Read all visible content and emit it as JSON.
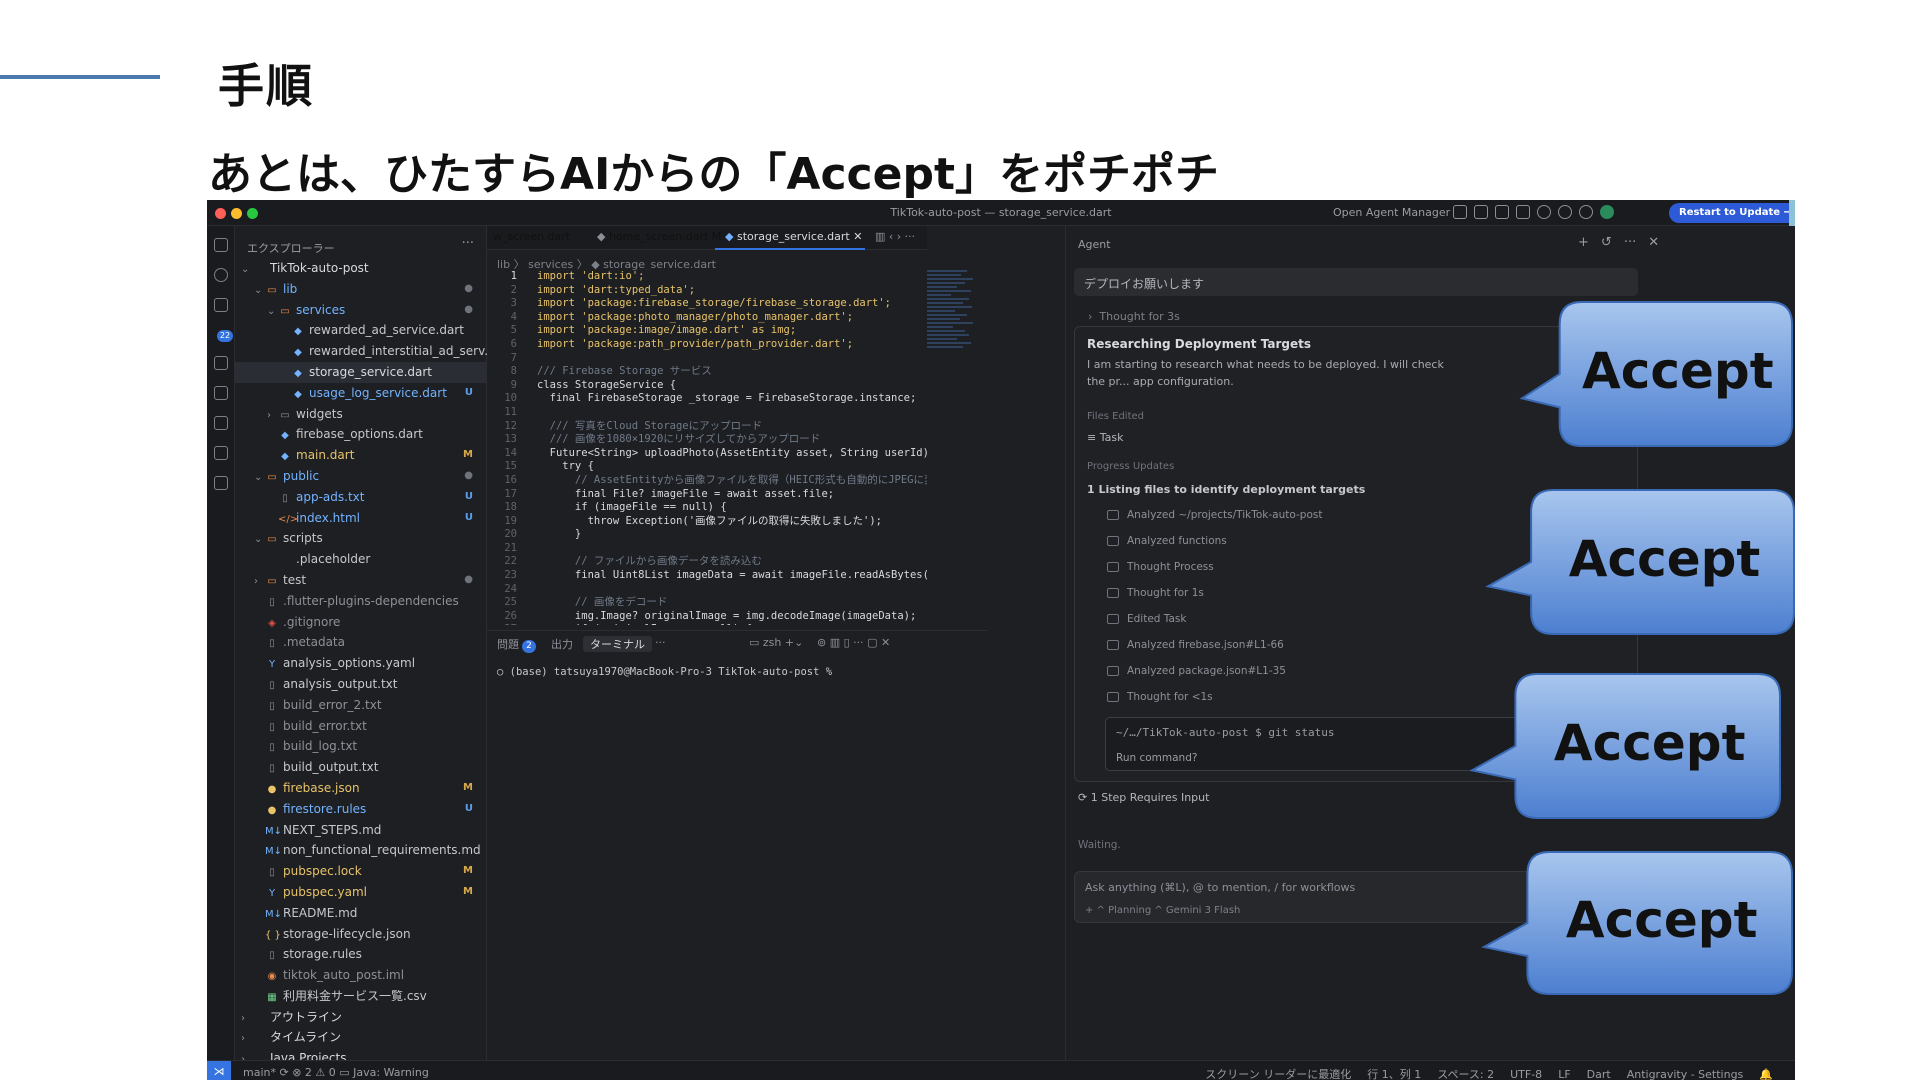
{
  "slide": {
    "title": "手順",
    "subtitle": "あとは、ひたすらAIからの「Accept」をポチポチ"
  },
  "window": {
    "title": "TikTok-auto-post — storage_service.dart",
    "open_agent_manager": "Open Agent Manager",
    "restart_button": "Restart to Update →"
  },
  "activity": {
    "badge": "22"
  },
  "explorer": {
    "header": "エクスプローラー",
    "more": "···",
    "rows": [
      {
        "indent": 0,
        "chev": "⌄",
        "icon": "",
        "icon_class": "",
        "label": "TikTok-auto-post",
        "label_class": "c-white",
        "status": "",
        "status_class": ""
      },
      {
        "indent": 1,
        "chev": "⌄",
        "icon": "▭",
        "icon_class": "c-org",
        "label": "lib",
        "label_class": "c-blue",
        "status": "●",
        "status_class": "st-dot"
      },
      {
        "indent": 2,
        "chev": "⌄",
        "icon": "▭",
        "icon_class": "c-org",
        "label": "services",
        "label_class": "c-blue",
        "status": "●",
        "status_class": "st-dot"
      },
      {
        "indent": 3,
        "chev": "",
        "icon": "◆",
        "icon_class": "c-blue",
        "label": "rewarded_ad_service.dart",
        "label_class": "",
        "status": "",
        "status_class": ""
      },
      {
        "indent": 3,
        "chev": "",
        "icon": "◆",
        "icon_class": "c-blue",
        "label": "rewarded_interstitial_ad_serv...",
        "label_class": "",
        "status": "",
        "status_class": ""
      },
      {
        "indent": 3,
        "chev": "",
        "icon": "◆",
        "icon_class": "c-blue",
        "label": "storage_service.dart",
        "label_class": "c-white",
        "status": "",
        "status_class": "",
        "selected": true
      },
      {
        "indent": 3,
        "chev": "",
        "icon": "◆",
        "icon_class": "c-blue",
        "label": "usage_log_service.dart",
        "label_class": "c-blue",
        "status": "U",
        "status_class": "st-U"
      },
      {
        "indent": 2,
        "chev": "›",
        "icon": "▭",
        "icon_class": "c-dim",
        "label": "widgets",
        "label_class": "",
        "status": "",
        "status_class": ""
      },
      {
        "indent": 2,
        "chev": "",
        "icon": "◆",
        "icon_class": "c-blue",
        "label": "firebase_options.dart",
        "label_class": "",
        "status": "",
        "status_class": ""
      },
      {
        "indent": 2,
        "chev": "",
        "icon": "◆",
        "icon_class": "c-blue",
        "label": "main.dart",
        "label_class": "c-yel",
        "status": "M",
        "status_class": "st-M"
      },
      {
        "indent": 1,
        "chev": "⌄",
        "icon": "▭",
        "icon_class": "c-org",
        "label": "public",
        "label_class": "c-blue",
        "status": "●",
        "status_class": "st-dot"
      },
      {
        "indent": 2,
        "chev": "",
        "icon": "▯",
        "icon_class": "c-dim",
        "label": "app-ads.txt",
        "label_class": "c-blue",
        "status": "U",
        "status_class": "st-U"
      },
      {
        "indent": 2,
        "chev": "",
        "icon": "</>",
        "icon_class": "c-org",
        "label": "index.html",
        "label_class": "c-blue",
        "status": "U",
        "status_class": "st-U"
      },
      {
        "indent": 1,
        "chev": "⌄",
        "icon": "▭",
        "icon_class": "c-org",
        "label": "scripts",
        "label_class": "",
        "status": "",
        "status_class": ""
      },
      {
        "indent": 2,
        "chev": "",
        "icon": "",
        "icon_class": "",
        "label": ".placeholder",
        "label_class": "",
        "status": "",
        "status_class": ""
      },
      {
        "indent": 1,
        "chev": "›",
        "icon": "▭",
        "icon_class": "c-org",
        "label": "test",
        "label_class": "",
        "status": "●",
        "status_class": "st-dot"
      },
      {
        "indent": 1,
        "chev": "",
        "icon": "▯",
        "icon_class": "c-dim",
        "label": ".flutter-plugins-dependencies",
        "label_class": "c-dim",
        "status": "",
        "status_class": ""
      },
      {
        "indent": 1,
        "chev": "",
        "icon": "◈",
        "icon_class": "c-red",
        "label": ".gitignore",
        "label_class": "c-dim",
        "status": "",
        "status_class": ""
      },
      {
        "indent": 1,
        "chev": "",
        "icon": "▯",
        "icon_class": "c-dim",
        "label": ".metadata",
        "label_class": "c-dim",
        "status": "",
        "status_class": ""
      },
      {
        "indent": 1,
        "chev": "",
        "icon": "Y",
        "icon_class": "c-blue",
        "label": "analysis_options.yaml",
        "label_class": "",
        "status": "",
        "status_class": ""
      },
      {
        "indent": 1,
        "chev": "",
        "icon": "▯",
        "icon_class": "c-dim",
        "label": "analysis_output.txt",
        "label_class": "",
        "status": "",
        "status_class": ""
      },
      {
        "indent": 1,
        "chev": "",
        "icon": "▯",
        "icon_class": "c-dim",
        "label": "build_error_2.txt",
        "label_class": "c-dim",
        "status": "",
        "status_class": ""
      },
      {
        "indent": 1,
        "chev": "",
        "icon": "▯",
        "icon_class": "c-dim",
        "label": "build_error.txt",
        "label_class": "c-dim",
        "status": "",
        "status_class": ""
      },
      {
        "indent": 1,
        "chev": "",
        "icon": "▯",
        "icon_class": "c-dim",
        "label": "build_log.txt",
        "label_class": "c-dim",
        "status": "",
        "status_class": ""
      },
      {
        "indent": 1,
        "chev": "",
        "icon": "▯",
        "icon_class": "c-dim",
        "label": "build_output.txt",
        "label_class": "",
        "status": "",
        "status_class": ""
      },
      {
        "indent": 1,
        "chev": "",
        "icon": "●",
        "icon_class": "c-yel",
        "label": "firebase.json",
        "label_class": "c-yel",
        "status": "M",
        "status_class": "st-M"
      },
      {
        "indent": 1,
        "chev": "",
        "icon": "●",
        "icon_class": "c-yel",
        "label": "firestore.rules",
        "label_class": "c-blue",
        "status": "U",
        "status_class": "st-U"
      },
      {
        "indent": 1,
        "chev": "",
        "icon": "M↓",
        "icon_class": "c-blue",
        "label": "NEXT_STEPS.md",
        "label_class": "",
        "status": "",
        "status_class": ""
      },
      {
        "indent": 1,
        "chev": "",
        "icon": "M↓",
        "icon_class": "c-blue",
        "label": "non_functional_requirements.md",
        "label_class": "",
        "status": "",
        "status_class": ""
      },
      {
        "indent": 1,
        "chev": "",
        "icon": "▯",
        "icon_class": "c-dim",
        "label": "pubspec.lock",
        "label_class": "c-yel",
        "status": "M",
        "status_class": "st-M"
      },
      {
        "indent": 1,
        "chev": "",
        "icon": "Y",
        "icon_class": "c-blue",
        "label": "pubspec.yaml",
        "label_class": "c-yel",
        "status": "M",
        "status_class": "st-M"
      },
      {
        "indent": 1,
        "chev": "",
        "icon": "M↓",
        "icon_class": "c-blue",
        "label": "README.md",
        "label_class": "",
        "status": "",
        "status_class": ""
      },
      {
        "indent": 1,
        "chev": "",
        "icon": "{ }",
        "icon_class": "c-yel",
        "label": "storage-lifecycle.json",
        "label_class": "",
        "status": "",
        "status_class": ""
      },
      {
        "indent": 1,
        "chev": "",
        "icon": "▯",
        "icon_class": "c-dim",
        "label": "storage.rules",
        "label_class": "",
        "status": "",
        "status_class": ""
      },
      {
        "indent": 1,
        "chev": "",
        "icon": "◉",
        "icon_class": "c-org",
        "label": "tiktok_auto_post.iml",
        "label_class": "c-dim",
        "status": "",
        "status_class": ""
      },
      {
        "indent": 1,
        "chev": "",
        "icon": "▦",
        "icon_class": "c-grn",
        "label": "利用料金サービス一覧.csv",
        "label_class": "",
        "status": "",
        "status_class": ""
      },
      {
        "indent": 0,
        "chev": "›",
        "icon": "",
        "icon_class": "",
        "label": "アウトライン",
        "label_class": "c-white",
        "status": "",
        "status_class": ""
      },
      {
        "indent": 0,
        "chev": "›",
        "icon": "",
        "icon_class": "",
        "label": "タイムライン",
        "label_class": "c-white",
        "status": "",
        "status_class": ""
      },
      {
        "indent": 0,
        "chev": "›",
        "icon": "",
        "icon_class": "",
        "label": "Java Projects",
        "label_class": "c-white",
        "status": "",
        "status_class": ""
      }
    ]
  },
  "editor": {
    "tabs": [
      {
        "label": "w_screen.dart",
        "class": "c-dim"
      },
      {
        "label": "home_screen.dart M",
        "class": "c-blue"
      },
      {
        "label": "storage_service.dart ✕",
        "class": "c-white"
      }
    ],
    "breadcrumb": "lib 〉 services 〉 ◆ storage_service.dart",
    "lines": [
      {
        "n": "1",
        "t": "import 'dart:io';"
      },
      {
        "n": "2",
        "t": "import 'dart:typed_data';"
      },
      {
        "n": "3",
        "t": "import 'package:firebase_storage/firebase_storage.dart';"
      },
      {
        "n": "4",
        "t": "import 'package:photo_manager/photo_manager.dart';"
      },
      {
        "n": "5",
        "t": "import 'package:image/image.dart' as img;"
      },
      {
        "n": "6",
        "t": "import 'package:path_provider/path_provider.dart';"
      },
      {
        "n": "7",
        "t": ""
      },
      {
        "n": "8",
        "t": "/// Firebase Storage サービス"
      },
      {
        "n": "9",
        "t": "class StorageService {"
      },
      {
        "n": "10",
        "t": "  final FirebaseStorage _storage = FirebaseStorage.instance;"
      },
      {
        "n": "11",
        "t": ""
      },
      {
        "n": "12",
        "t": "  /// 写真をCloud Storageにアップロード"
      },
      {
        "n": "13",
        "t": "  /// 画像を1080×1920にリサイズしてからアップロード"
      },
      {
        "n": "14",
        "t": "  Future<String> uploadPhoto(AssetEntity asset, String userId)"
      },
      {
        "n": "15",
        "t": "    try {"
      },
      {
        "n": "16",
        "t": "      // AssetEntityから画像ファイルを取得（HEIC形式も自動的にJPEGに変"
      },
      {
        "n": "17",
        "t": "      final File? imageFile = await asset.file;"
      },
      {
        "n": "18",
        "t": "      if (imageFile == null) {"
      },
      {
        "n": "19",
        "t": "        throw Exception('画像ファイルの取得に失敗しました');"
      },
      {
        "n": "20",
        "t": "      }"
      },
      {
        "n": "21",
        "t": ""
      },
      {
        "n": "22",
        "t": "      // ファイルから画像データを読み込む"
      },
      {
        "n": "23",
        "t": "      final Uint8List imageData = await imageFile.readAsBytes("
      },
      {
        "n": "24",
        "t": ""
      },
      {
        "n": "25",
        "t": "      // 画像をデコード"
      },
      {
        "n": "26",
        "t": "      img.Image? originalImage = img.decodeImage(imageData);"
      },
      {
        "n": "27",
        "t": "      if (originalImage == null) {"
      }
    ]
  },
  "panel": {
    "problems": "問題",
    "problems_count": "2",
    "output": "出力",
    "terminal": "ターミナル",
    "more": "···",
    "shell": "zsh",
    "prompt": "(base) tatsuya1970@MacBook-Pro-3 TikTok-auto-post %"
  },
  "agent": {
    "label": "Agent",
    "prompt": "デプロイお願いします",
    "thought_1": "Thought for 3s",
    "card_title": "Researching Deployment Targets",
    "card_body": "I am starting to research what needs to be deployed. I will check the pr... app configuration.",
    "files_edited_label": "Files Edited",
    "files_edited_item": "Task",
    "progress_label": "Progress Updates",
    "step_head": "1  Listing files to identify deployment targets",
    "steps": [
      "Analyzed ~/projects/TikTok-auto-post",
      "Analyzed functions",
      "Thought Process",
      "Thought for 1s",
      "Edited  Task",
      "Analyzed  firebase.json#L1-66",
      "Analyzed  package.json#L1-35",
      "Thought for <1s"
    ],
    "term_cmd": "~/…/TikTok-auto-post $ git status",
    "run_command": "Run command?",
    "requires_input": "1 Step Requires Input",
    "waiting": "Waiting.",
    "ask_placeholder": "Ask anything (⌘L), @ to mention, / for workflows",
    "ask_options": "+     ^ Planning      ^ Gemini 3 Flash"
  },
  "statusbar": {
    "left": "main*  ⟳   ⊗ 2 ⚠ 0   ▭ Java: Warning",
    "items": [
      "スクリーン リーダーに最適化",
      "行 1、列 1",
      "スペース: 2",
      "UTF-8",
      "LF",
      "Dart",
      "Antigravity - Settings"
    ]
  },
  "callouts": [
    {
      "label": "Accept"
    },
    {
      "label": "Accept"
    },
    {
      "label": "Accept"
    },
    {
      "label": "Accept"
    }
  ],
  "colors": {
    "slide_accent_line": "#4b79ae",
    "callout_fill_top": "#a8c6ee",
    "callout_fill_bottom": "#4d7fd0",
    "callout_stroke": "#3a6ab5",
    "ide_background": "#1e1f22",
    "ide_accent": "#3473e0"
  }
}
